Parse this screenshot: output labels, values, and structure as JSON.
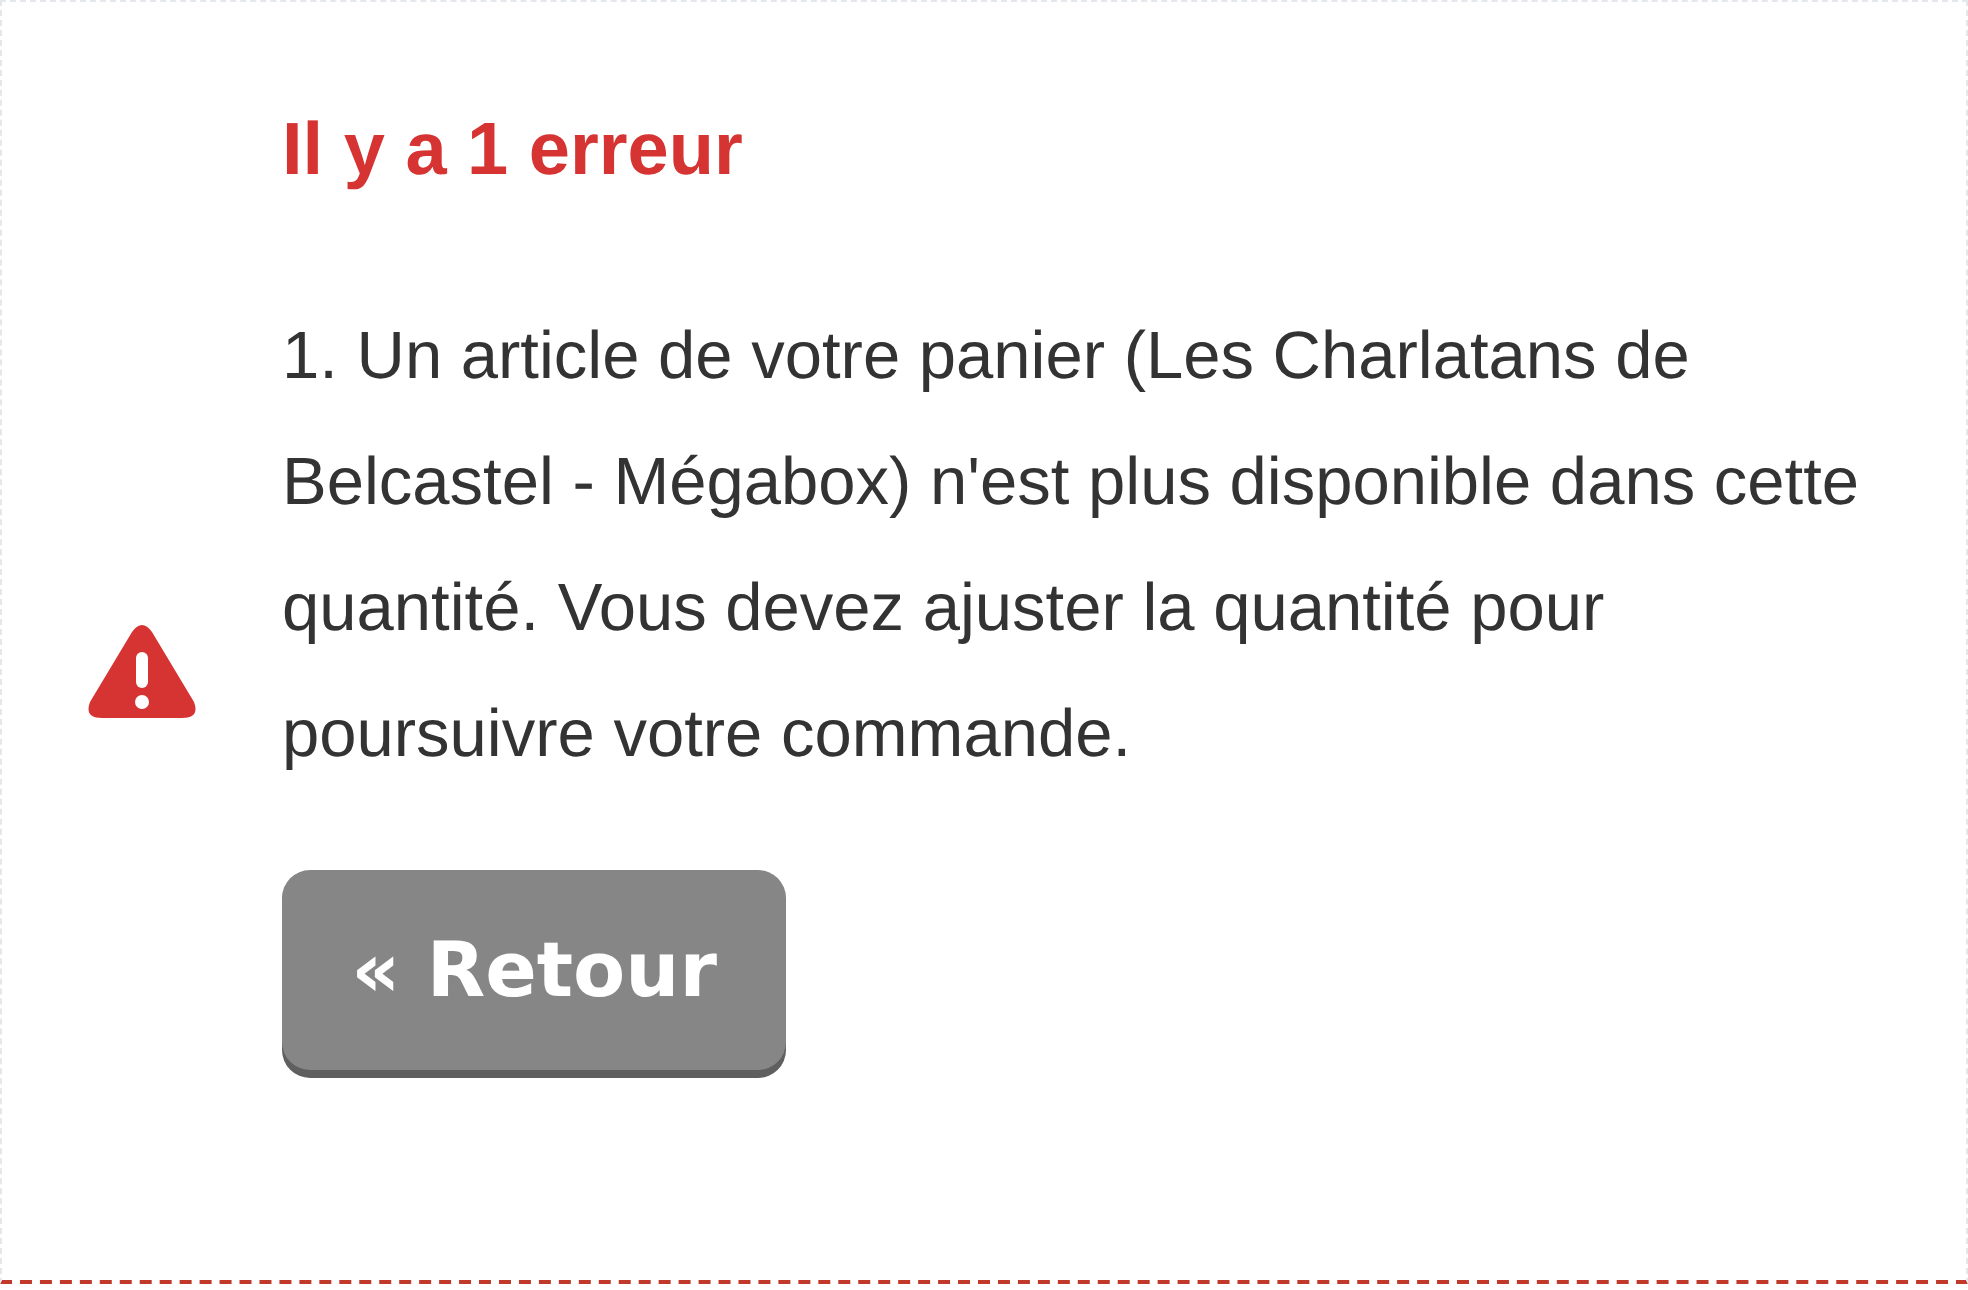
{
  "alert": {
    "kind": "error",
    "title": "Il y a 1 erreur",
    "errors": [
      "1. Un article de votre panier (Les Charlatans de Belcastel - Mégabox) n'est plus disponible dans cette quantité. Vous devez ajuster la quantité pour poursuivre votre commande."
    ]
  },
  "buttons": [
    {
      "label": "« Retour"
    }
  ]
}
